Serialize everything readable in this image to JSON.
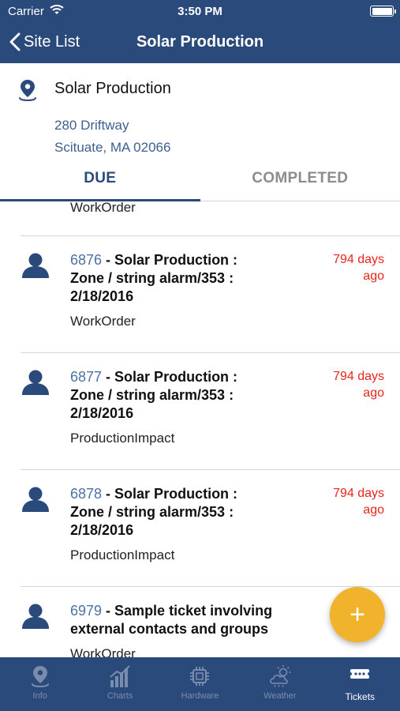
{
  "status_bar": {
    "carrier": "Carrier",
    "time": "3:50 PM"
  },
  "nav": {
    "back_label": "Site List",
    "title": "Solar Production"
  },
  "site": {
    "name": "Solar Production",
    "address_line1": "280 Driftway",
    "address_line2": "Scituate, MA 02066"
  },
  "tabs": [
    {
      "label": "DUE",
      "active": true
    },
    {
      "label": "COMPLETED",
      "active": false
    }
  ],
  "list": {
    "partial_type": "WorkOrder",
    "tickets": [
      {
        "id": "6876",
        "title_rest": " - Solar Production : Zone / string alarm/353 : 2/18/2016",
        "type": "WorkOrder",
        "age_line1": "794 days",
        "age_line2": "ago"
      },
      {
        "id": "6877",
        "title_rest": " - Solar Production : Zone / string alarm/353 : 2/18/2016",
        "type": "ProductionImpact",
        "age_line1": "794 days",
        "age_line2": "ago"
      },
      {
        "id": "6878",
        "title_rest": " - Solar Production : Zone / string alarm/353 : 2/18/2016",
        "type": "ProductionImpact",
        "age_line1": "794 days",
        "age_line2": "ago"
      },
      {
        "id": "6979",
        "title_rest": " - Sample ticket involving external contacts and groups",
        "type": "WorkOrder",
        "age_line1": "",
        "age_line2": ""
      }
    ]
  },
  "fab": {
    "label": "+"
  },
  "tab_bar": [
    {
      "label": "Info",
      "icon": "map-pin-icon",
      "active": false
    },
    {
      "label": "Charts",
      "icon": "bar-chart-icon",
      "active": false
    },
    {
      "label": "Hardware",
      "icon": "chip-icon",
      "active": false
    },
    {
      "label": "Weather",
      "icon": "cloud-sun-icon",
      "active": false
    },
    {
      "label": "Tickets",
      "icon": "ticket-icon",
      "active": true
    }
  ],
  "colors": {
    "primary": "#2b4a7c",
    "accent": "#f1b32b",
    "overdue": "#e8241b",
    "link": "#4a73a3"
  }
}
